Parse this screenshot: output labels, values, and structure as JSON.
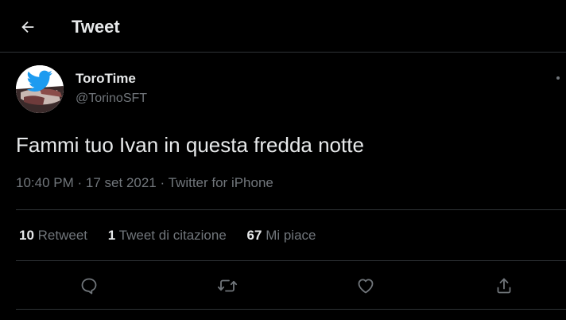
{
  "header": {
    "title": "Tweet",
    "back_icon": "arrow-left-icon"
  },
  "tweet": {
    "author": {
      "display_name": "ToroTime",
      "handle": "@TorinoSFT",
      "avatar_icon": "twitter-bird-icon"
    },
    "text": "Fammi tuo Ivan in questa fredda notte",
    "time": "10:40 PM",
    "date": "17 set 2021",
    "source": "Twitter for iPhone",
    "separator": "·"
  },
  "stats": {
    "retweets": {
      "count": "10",
      "label": "Retweet"
    },
    "quotes": {
      "count": "1",
      "label": "Tweet di citazione"
    },
    "likes": {
      "count": "67",
      "label": "Mi piace"
    }
  },
  "actions": [
    {
      "icon": "reply-icon"
    },
    {
      "icon": "retweet-icon"
    },
    {
      "icon": "like-icon"
    },
    {
      "icon": "share-icon"
    }
  ],
  "colors": {
    "background": "#000000",
    "text_primary": "#e7e9ea",
    "text_secondary": "#71767b",
    "border": "#2f3336",
    "brand_blue": "#1d9bf0"
  }
}
